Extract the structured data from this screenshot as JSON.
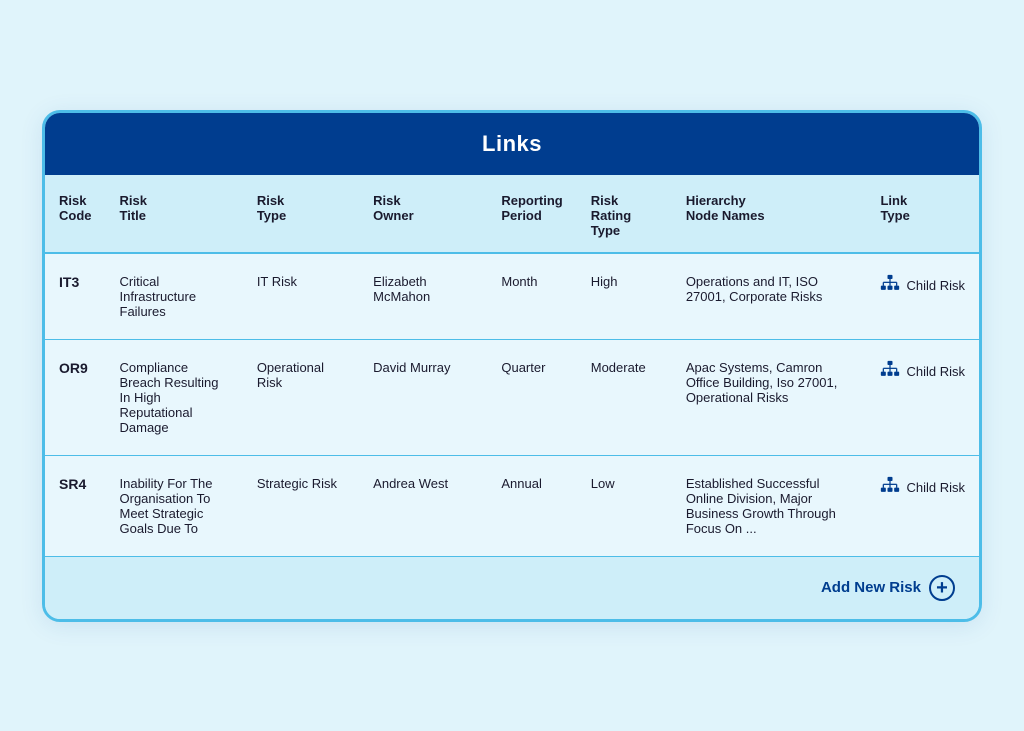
{
  "header": {
    "title": "Links"
  },
  "columns": [
    {
      "id": "risk_code",
      "label_line1": "Risk",
      "label_line2": "Code"
    },
    {
      "id": "risk_title",
      "label_line1": "Risk",
      "label_line2": "Title"
    },
    {
      "id": "risk_type",
      "label_line1": "Risk",
      "label_line2": "Type"
    },
    {
      "id": "risk_owner",
      "label_line1": "Risk",
      "label_line2": "Owner"
    },
    {
      "id": "reporting_period",
      "label_line1": "Reporting",
      "label_line2": "Period"
    },
    {
      "id": "risk_rating_type",
      "label_line1": "Risk Rating",
      "label_line2": "Type"
    },
    {
      "id": "hierarchy_node_names",
      "label_line1": "Hierarchy",
      "label_line2": "Node Names"
    },
    {
      "id": "link_type",
      "label_line1": "Link",
      "label_line2": "Type"
    }
  ],
  "rows": [
    {
      "risk_code": "IT3",
      "risk_title": "Critical Infrastructure Failures",
      "risk_type": "IT Risk",
      "risk_owner": "Elizabeth McMahon",
      "reporting_period": "Month",
      "risk_rating_type": "High",
      "hierarchy_node_names": "Operations and IT, ISO 27001, Corporate Risks",
      "link_type": "Child Risk"
    },
    {
      "risk_code": "OR9",
      "risk_title": "Compliance Breach Resulting In High Reputational Damage",
      "risk_type": "Operational Risk",
      "risk_owner": "David Murray",
      "reporting_period": "Quarter",
      "risk_rating_type": "Moderate",
      "hierarchy_node_names": "Apac Systems, Camron Office Building, Iso 27001, Operational Risks",
      "link_type": "Child Risk"
    },
    {
      "risk_code": "SR4",
      "risk_title": "Inability For The Organisation To Meet Strategic Goals Due To",
      "risk_type": "Strategic Risk",
      "risk_owner": "Andrea West",
      "reporting_period": "Annual",
      "risk_rating_type": "Low",
      "hierarchy_node_names": "Established Successful Online Division, Major Business Growth Through Focus On ...",
      "link_type": "Child Risk"
    }
  ],
  "footer": {
    "add_new_risk_label": "Add New Risk"
  },
  "colors": {
    "header_bg": "#003d8f",
    "header_text": "#ffffff",
    "table_header_bg": "#ceeef9",
    "card_border": "#4dbde8",
    "card_bg": "#e8f7fd",
    "footer_bg": "#ceeef9",
    "add_button_color": "#003d8f"
  }
}
